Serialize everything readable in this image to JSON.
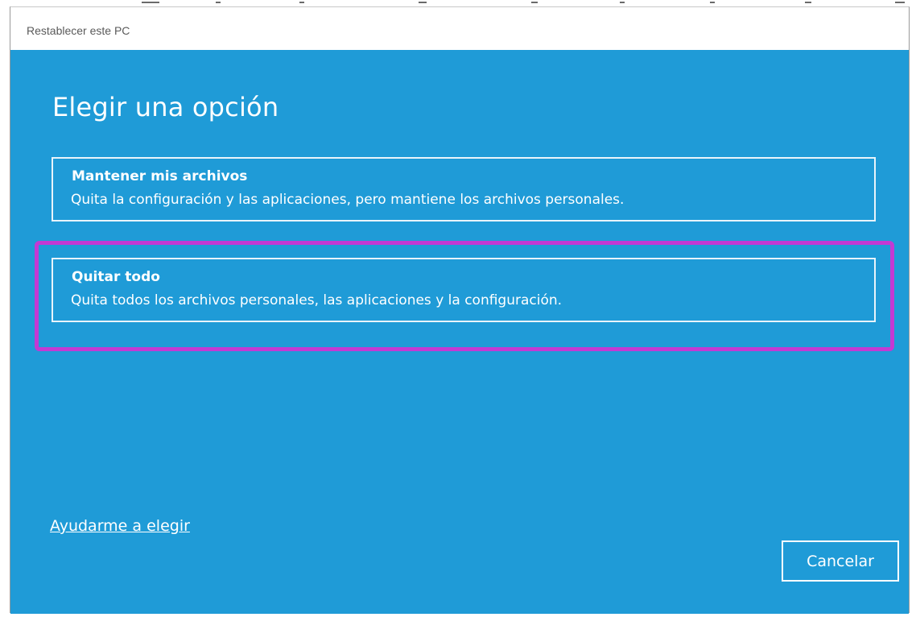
{
  "window": {
    "title": "Restablecer este PC"
  },
  "main": {
    "heading": "Elegir una opción",
    "options": [
      {
        "title": "Mantener mis archivos",
        "description": "Quita la configuración y las aplicaciones, pero mantiene los archivos personales."
      },
      {
        "title": "Quitar todo",
        "description": "Quita todos los archivos personales, las aplicaciones y la configuración."
      }
    ]
  },
  "footer": {
    "help_link": "Ayudarme a elegir",
    "cancel_label": "Cancelar"
  },
  "colors": {
    "background": "#1f9bd7",
    "highlight": "#c339d3",
    "text": "#ffffff"
  }
}
